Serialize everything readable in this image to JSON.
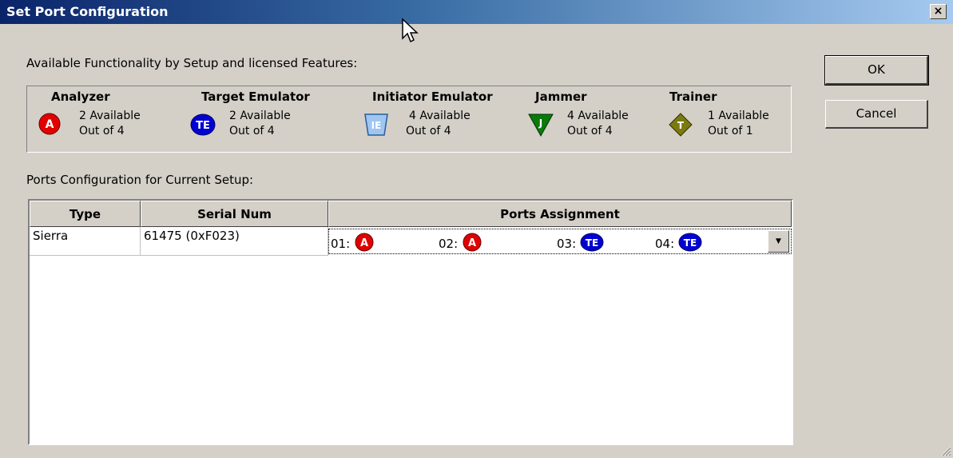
{
  "window": {
    "title": "Set Port Configuration",
    "close_label": "×"
  },
  "available": {
    "heading": "Available Functionality by Setup and licensed Features:",
    "features": [
      {
        "title": "Analyzer",
        "icon": "analyzer-circle-icon",
        "badge": "A",
        "color": "#e00000",
        "available": "2 Available",
        "out_of": "Out of 4"
      },
      {
        "title": "Target Emulator",
        "icon": "target-emulator-icon",
        "badge": "TE",
        "color": "#0000d0",
        "available": "2 Available",
        "out_of": "Out of 4"
      },
      {
        "title": "Initiator Emulator",
        "icon": "initiator-emulator-icon",
        "badge": "IE",
        "color": "#9ec6f0",
        "available": "4 Available",
        "out_of": "Out of 4"
      },
      {
        "title": "Jammer",
        "icon": "jammer-triangle-icon",
        "badge": "J",
        "color": "#0a7a0a",
        "available": "4 Available",
        "out_of": "Out of 4"
      },
      {
        "title": "Trainer",
        "icon": "trainer-diamond-icon",
        "badge": "T",
        "color": "#7a7a10",
        "available": "1 Available",
        "out_of": "Out of 1"
      }
    ]
  },
  "buttons": {
    "ok": "OK",
    "cancel": "Cancel"
  },
  "ports_config": {
    "heading": "Ports Configuration for Current Setup:",
    "columns": [
      "Type",
      "Serial Num",
      "Ports Assignment"
    ],
    "rows": [
      {
        "type": "Sierra",
        "serial": "61475 (0xF023)",
        "ports": [
          {
            "label": "01:",
            "badge": "A",
            "color": "#e00000"
          },
          {
            "label": "02:",
            "badge": "A",
            "color": "#e00000"
          },
          {
            "label": "03:",
            "badge": "TE",
            "color": "#0000d0"
          },
          {
            "label": "04:",
            "badge": "TE",
            "color": "#0000d0"
          }
        ]
      }
    ]
  }
}
